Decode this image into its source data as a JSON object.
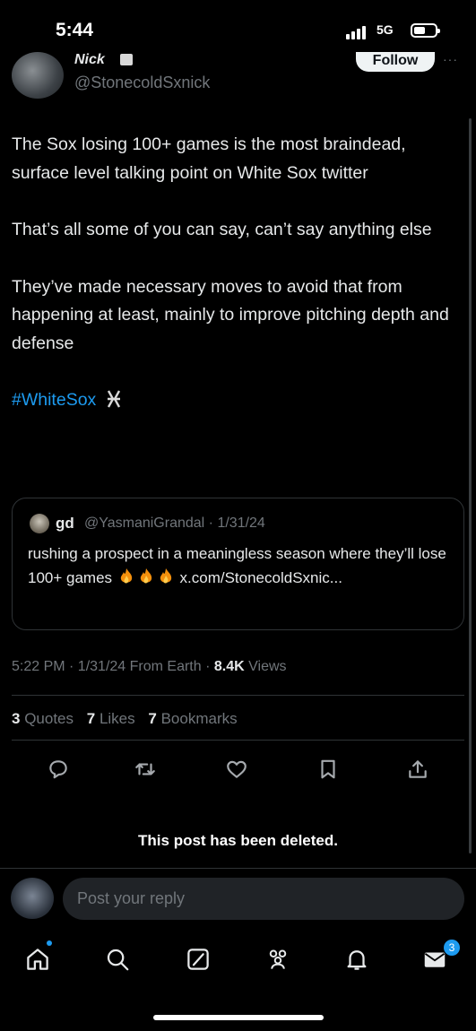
{
  "status_bar": {
    "time": "5:44",
    "network": "5G"
  },
  "author": {
    "display_name": "Nick",
    "handle": "@StonecoldSxnick",
    "follow_label": "Follow",
    "more_label": "···"
  },
  "tweet": {
    "paragraphs": [
      "The Sox losing 100+ games is the most braindead, surface level talking point on White Sox twitter",
      "That’s all some of you can say, can’t say anything else",
      "They’ve made necessary moves to avoid that from happening at least, mainly to improve pitching depth and defense"
    ],
    "hashtag": "#WhiteSox"
  },
  "quote": {
    "name": "gd",
    "handle_date": "@YasmaniGrandal · 1/31/24",
    "text_before": "rushing a prospect in a meaningless season where they’ll lose 100+ games",
    "text_link": "x.com/StonecoldSxnic..."
  },
  "meta": {
    "time_date": "5:22 PM · 1/31/24 From Earth ·",
    "views_count": "8.4K",
    "views_label": "Views"
  },
  "stats": {
    "quotes_count": "3",
    "quotes_label": "Quotes",
    "likes_count": "7",
    "likes_label": "Likes",
    "bookmarks_count": "7",
    "bookmarks_label": "Bookmarks"
  },
  "deleted_notice": "This post has been deleted.",
  "reply": {
    "placeholder": "Post your reply"
  },
  "nav": {
    "messages_badge": "3"
  },
  "colors": {
    "accent": "#1d9bf0",
    "background": "#000000",
    "muted": "#71767b"
  }
}
